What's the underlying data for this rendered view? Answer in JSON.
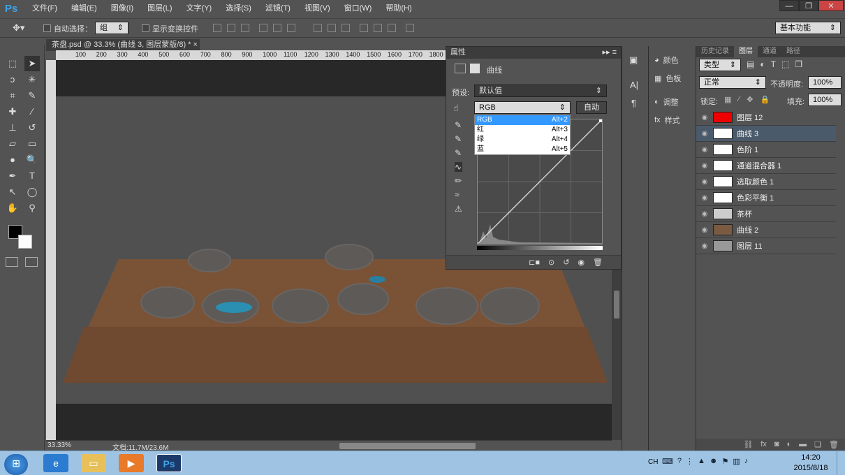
{
  "app": {
    "logo": "Ps",
    "menus": [
      "文件(F)",
      "编辑(E)",
      "图像(I)",
      "图层(L)",
      "文字(Y)",
      "选择(S)",
      "滤镜(T)",
      "视图(V)",
      "窗口(W)",
      "帮助(H)"
    ]
  },
  "window_controls": [
    "—",
    "❐",
    "✕"
  ],
  "options": {
    "auto_select_label": "自动选择：",
    "auto_select_value": "组",
    "show_transform_label": "显示变换控件",
    "workspace": "基本功能"
  },
  "document": {
    "tab_title": "茶盘.psd @ 33.3% (曲线 3, 图层蒙版/8) *",
    "close": "×",
    "zoom": "33.33%",
    "doc_size": "文档:11.7M/23.6M"
  },
  "ruler": {
    "h_ticks": [
      "100",
      "200",
      "300",
      "400",
      "500",
      "600",
      "700",
      "800",
      "900",
      "1000",
      "1100",
      "1200",
      "1300",
      "1400",
      "1500",
      "1600",
      "1700",
      "1800"
    ]
  },
  "properties": {
    "tab": "属性",
    "title": "曲线",
    "preset_label": "预设:",
    "preset_value": "默认值",
    "channel_value": "RGB",
    "auto_button": "自动",
    "channel_options": [
      {
        "label": "RGB",
        "shortcut": "Alt+2"
      },
      {
        "label": "红",
        "shortcut": "Alt+3"
      },
      {
        "label": "绿",
        "shortcut": "Alt+4"
      },
      {
        "label": "蓝",
        "shortcut": "Alt+5"
      }
    ]
  },
  "side_panels": [
    {
      "icon": "palette-icon",
      "label": "颜色"
    },
    {
      "icon": "swatches-icon",
      "label": "色板"
    },
    {
      "icon": "adjustments-icon",
      "label": "调整"
    },
    {
      "icon": "styles-icon",
      "label": "样式"
    }
  ],
  "layers_panel": {
    "tabs": [
      "历史记录",
      "图层",
      "通道",
      "路径"
    ],
    "active_tab": "图层",
    "filter": "类型",
    "blend": "正常",
    "opacity_label": "不透明度:",
    "opacity": "100%",
    "lock_label": "锁定:",
    "fill_label": "填充:",
    "fill": "100%",
    "layers": [
      {
        "name": "图层 12",
        "thumb": "#ee0000",
        "selected": false
      },
      {
        "name": "曲线 3",
        "thumb": "#ffffff",
        "selected": true
      },
      {
        "name": "色阶 1",
        "thumb": "#ffffff",
        "selected": false
      },
      {
        "name": "通道混合器 1",
        "thumb": "#ffffff",
        "selected": false
      },
      {
        "name": "选取颜色 1",
        "thumb": "#ffffff",
        "selected": false
      },
      {
        "name": "色彩平衡 1",
        "thumb": "#ffffff",
        "selected": false
      },
      {
        "name": "茶杯",
        "thumb": "#cccccc",
        "selected": false
      },
      {
        "name": "曲线 2",
        "thumb": "#7a5a40",
        "selected": false
      },
      {
        "name": "图层 11",
        "thumb": "#999999",
        "selected": false
      }
    ]
  },
  "taskbar": {
    "lang": "CH",
    "time": "14:20",
    "date": "2015/8/18"
  }
}
